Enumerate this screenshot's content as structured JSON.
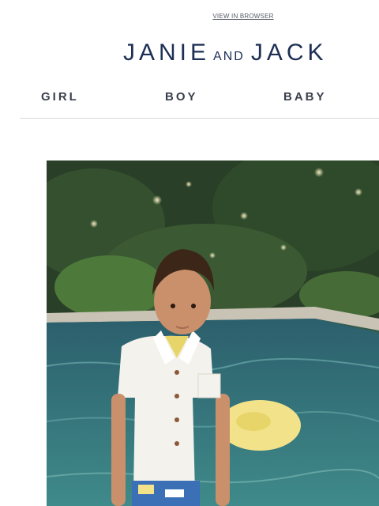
{
  "header": {
    "view_in_browser": "VIEW IN BROWSER"
  },
  "logo": {
    "word1": "JANIE",
    "connector": "AND",
    "word2": "JACK"
  },
  "nav": {
    "items": [
      {
        "label": "GIRL"
      },
      {
        "label": "BOY"
      },
      {
        "label": "BABY"
      }
    ]
  },
  "hero": {
    "image": "hero-photo",
    "colors": {
      "foliage": "#2f4a2c",
      "pool_water": "#2e6670",
      "pool_edge": "#c9c3b6",
      "float": "#f2e38a",
      "shirt": "#f4f2ec",
      "brand_navy": "#1d2f55"
    }
  }
}
